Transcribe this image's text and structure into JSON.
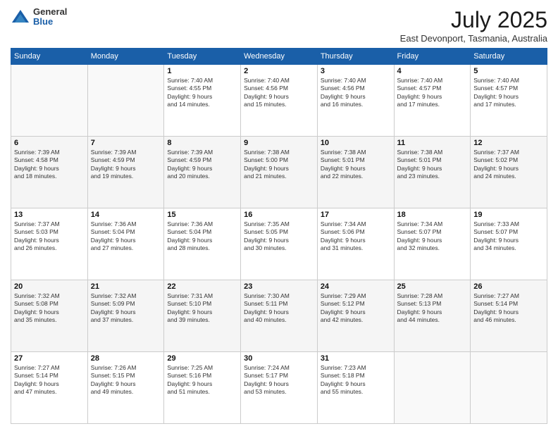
{
  "logo": {
    "general": "General",
    "blue": "Blue"
  },
  "title": {
    "month_year": "July 2025",
    "location": "East Devonport, Tasmania, Australia"
  },
  "headers": [
    "Sunday",
    "Monday",
    "Tuesday",
    "Wednesday",
    "Thursday",
    "Friday",
    "Saturday"
  ],
  "weeks": [
    {
      "shaded": false,
      "days": [
        {
          "num": "",
          "lines": []
        },
        {
          "num": "",
          "lines": []
        },
        {
          "num": "1",
          "lines": [
            "Sunrise: 7:40 AM",
            "Sunset: 4:55 PM",
            "Daylight: 9 hours",
            "and 14 minutes."
          ]
        },
        {
          "num": "2",
          "lines": [
            "Sunrise: 7:40 AM",
            "Sunset: 4:56 PM",
            "Daylight: 9 hours",
            "and 15 minutes."
          ]
        },
        {
          "num": "3",
          "lines": [
            "Sunrise: 7:40 AM",
            "Sunset: 4:56 PM",
            "Daylight: 9 hours",
            "and 16 minutes."
          ]
        },
        {
          "num": "4",
          "lines": [
            "Sunrise: 7:40 AM",
            "Sunset: 4:57 PM",
            "Daylight: 9 hours",
            "and 17 minutes."
          ]
        },
        {
          "num": "5",
          "lines": [
            "Sunrise: 7:40 AM",
            "Sunset: 4:57 PM",
            "Daylight: 9 hours",
            "and 17 minutes."
          ]
        }
      ]
    },
    {
      "shaded": true,
      "days": [
        {
          "num": "6",
          "lines": [
            "Sunrise: 7:39 AM",
            "Sunset: 4:58 PM",
            "Daylight: 9 hours",
            "and 18 minutes."
          ]
        },
        {
          "num": "7",
          "lines": [
            "Sunrise: 7:39 AM",
            "Sunset: 4:59 PM",
            "Daylight: 9 hours",
            "and 19 minutes."
          ]
        },
        {
          "num": "8",
          "lines": [
            "Sunrise: 7:39 AM",
            "Sunset: 4:59 PM",
            "Daylight: 9 hours",
            "and 20 minutes."
          ]
        },
        {
          "num": "9",
          "lines": [
            "Sunrise: 7:38 AM",
            "Sunset: 5:00 PM",
            "Daylight: 9 hours",
            "and 21 minutes."
          ]
        },
        {
          "num": "10",
          "lines": [
            "Sunrise: 7:38 AM",
            "Sunset: 5:01 PM",
            "Daylight: 9 hours",
            "and 22 minutes."
          ]
        },
        {
          "num": "11",
          "lines": [
            "Sunrise: 7:38 AM",
            "Sunset: 5:01 PM",
            "Daylight: 9 hours",
            "and 23 minutes."
          ]
        },
        {
          "num": "12",
          "lines": [
            "Sunrise: 7:37 AM",
            "Sunset: 5:02 PM",
            "Daylight: 9 hours",
            "and 24 minutes."
          ]
        }
      ]
    },
    {
      "shaded": false,
      "days": [
        {
          "num": "13",
          "lines": [
            "Sunrise: 7:37 AM",
            "Sunset: 5:03 PM",
            "Daylight: 9 hours",
            "and 26 minutes."
          ]
        },
        {
          "num": "14",
          "lines": [
            "Sunrise: 7:36 AM",
            "Sunset: 5:04 PM",
            "Daylight: 9 hours",
            "and 27 minutes."
          ]
        },
        {
          "num": "15",
          "lines": [
            "Sunrise: 7:36 AM",
            "Sunset: 5:04 PM",
            "Daylight: 9 hours",
            "and 28 minutes."
          ]
        },
        {
          "num": "16",
          "lines": [
            "Sunrise: 7:35 AM",
            "Sunset: 5:05 PM",
            "Daylight: 9 hours",
            "and 30 minutes."
          ]
        },
        {
          "num": "17",
          "lines": [
            "Sunrise: 7:34 AM",
            "Sunset: 5:06 PM",
            "Daylight: 9 hours",
            "and 31 minutes."
          ]
        },
        {
          "num": "18",
          "lines": [
            "Sunrise: 7:34 AM",
            "Sunset: 5:07 PM",
            "Daylight: 9 hours",
            "and 32 minutes."
          ]
        },
        {
          "num": "19",
          "lines": [
            "Sunrise: 7:33 AM",
            "Sunset: 5:07 PM",
            "Daylight: 9 hours",
            "and 34 minutes."
          ]
        }
      ]
    },
    {
      "shaded": true,
      "days": [
        {
          "num": "20",
          "lines": [
            "Sunrise: 7:32 AM",
            "Sunset: 5:08 PM",
            "Daylight: 9 hours",
            "and 35 minutes."
          ]
        },
        {
          "num": "21",
          "lines": [
            "Sunrise: 7:32 AM",
            "Sunset: 5:09 PM",
            "Daylight: 9 hours",
            "and 37 minutes."
          ]
        },
        {
          "num": "22",
          "lines": [
            "Sunrise: 7:31 AM",
            "Sunset: 5:10 PM",
            "Daylight: 9 hours",
            "and 39 minutes."
          ]
        },
        {
          "num": "23",
          "lines": [
            "Sunrise: 7:30 AM",
            "Sunset: 5:11 PM",
            "Daylight: 9 hours",
            "and 40 minutes."
          ]
        },
        {
          "num": "24",
          "lines": [
            "Sunrise: 7:29 AM",
            "Sunset: 5:12 PM",
            "Daylight: 9 hours",
            "and 42 minutes."
          ]
        },
        {
          "num": "25",
          "lines": [
            "Sunrise: 7:28 AM",
            "Sunset: 5:13 PM",
            "Daylight: 9 hours",
            "and 44 minutes."
          ]
        },
        {
          "num": "26",
          "lines": [
            "Sunrise: 7:27 AM",
            "Sunset: 5:14 PM",
            "Daylight: 9 hours",
            "and 46 minutes."
          ]
        }
      ]
    },
    {
      "shaded": false,
      "days": [
        {
          "num": "27",
          "lines": [
            "Sunrise: 7:27 AM",
            "Sunset: 5:14 PM",
            "Daylight: 9 hours",
            "and 47 minutes."
          ]
        },
        {
          "num": "28",
          "lines": [
            "Sunrise: 7:26 AM",
            "Sunset: 5:15 PM",
            "Daylight: 9 hours",
            "and 49 minutes."
          ]
        },
        {
          "num": "29",
          "lines": [
            "Sunrise: 7:25 AM",
            "Sunset: 5:16 PM",
            "Daylight: 9 hours",
            "and 51 minutes."
          ]
        },
        {
          "num": "30",
          "lines": [
            "Sunrise: 7:24 AM",
            "Sunset: 5:17 PM",
            "Daylight: 9 hours",
            "and 53 minutes."
          ]
        },
        {
          "num": "31",
          "lines": [
            "Sunrise: 7:23 AM",
            "Sunset: 5:18 PM",
            "Daylight: 9 hours",
            "and 55 minutes."
          ]
        },
        {
          "num": "",
          "lines": []
        },
        {
          "num": "",
          "lines": []
        }
      ]
    }
  ]
}
